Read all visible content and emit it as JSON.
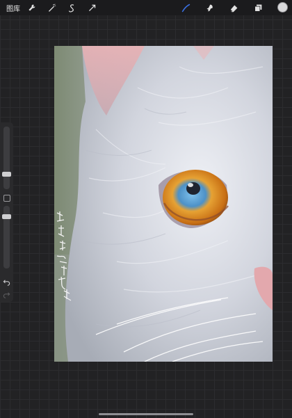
{
  "topbar": {
    "gallery_label": "图库",
    "left_tools": [
      "wrench-icon",
      "magic-wand-icon",
      "selection-s-icon",
      "transform-arrow-icon"
    ],
    "right_tools": [
      "brush-icon",
      "smudge-icon",
      "eraser-icon",
      "layers-icon"
    ],
    "active_tool": "brush",
    "active_color": "#3a6fe0",
    "current_color": "#d9d9db"
  },
  "sidebar": {
    "brush_size": 0.48,
    "opacity": 0.24,
    "icons": [
      "undo-icon",
      "redo-icon"
    ]
  },
  "canvas": {
    "subject": "cat-eye-painting",
    "eye_iris_color": "#d58a1f",
    "eye_pupil_color": "#6fb2e4"
  }
}
